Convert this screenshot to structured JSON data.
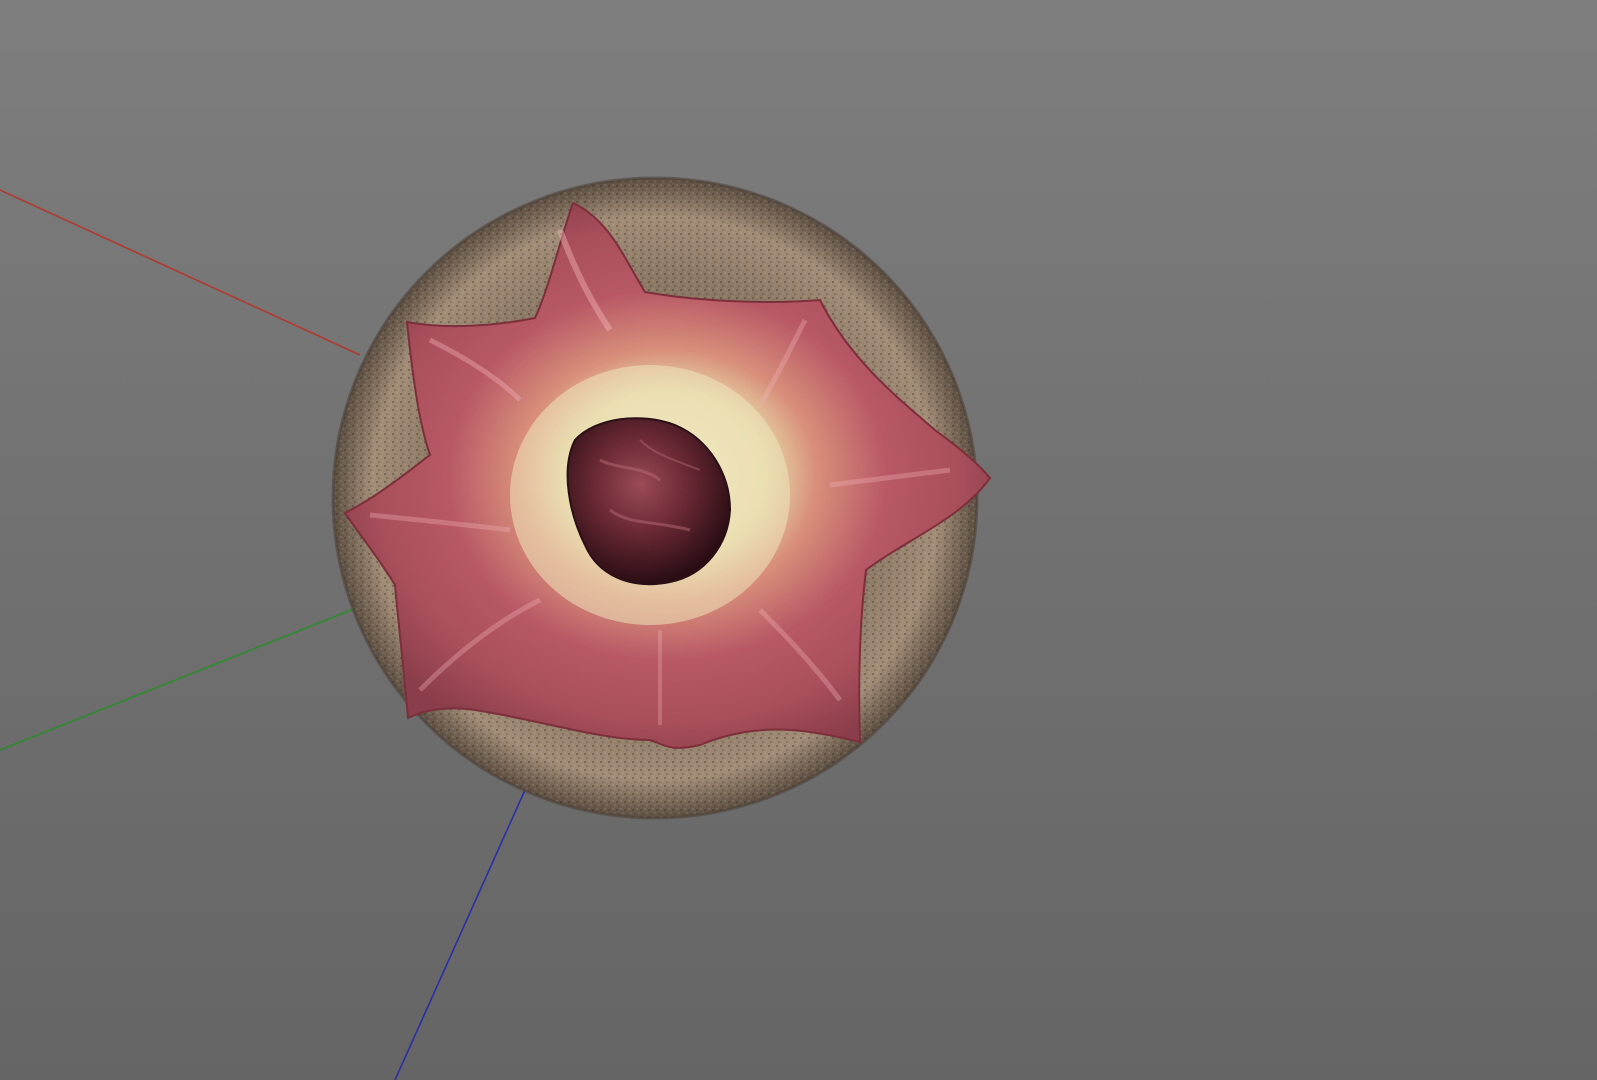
{
  "viewport": {
    "background_top": "#7e7e7e",
    "background_bottom": "#656565"
  },
  "axes": {
    "x_axis_color": "#b03a30",
    "y_axis_color": "#2f8a2f",
    "z_axis_color": "#2b2fa8"
  },
  "model": {
    "icon": "3d-model-icon",
    "outer_disc_color": "#8f7a66",
    "petal_color": "#b85a66",
    "petal_highlight": "#e7a1a6",
    "inner_glow_color": "#e9e1b3",
    "core_color": "#5b1f2a"
  }
}
